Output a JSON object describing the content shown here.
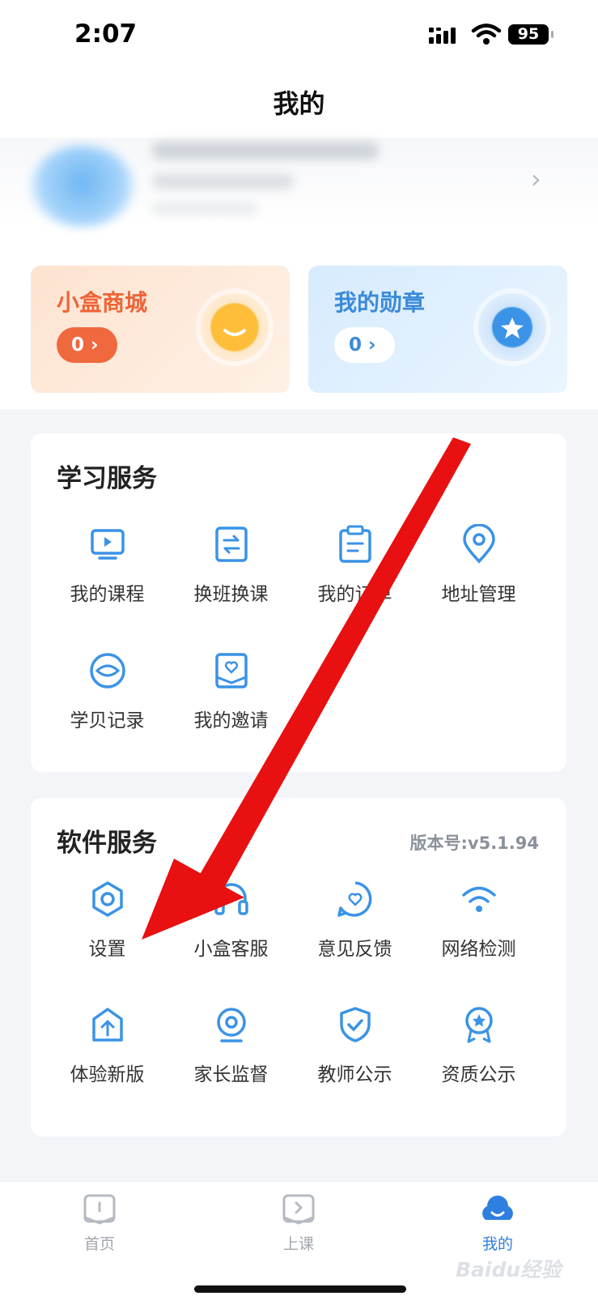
{
  "status": {
    "time": "2:07",
    "battery": "95"
  },
  "page_title": "我的",
  "mall": {
    "title": "小盒商城",
    "count": "0"
  },
  "medal": {
    "title": "我的勋章",
    "count": "0"
  },
  "study": {
    "title": "学习服务",
    "items": [
      {
        "label": "我的课程",
        "icon": "course-icon"
      },
      {
        "label": "换班换课",
        "icon": "switch-class-icon"
      },
      {
        "label": "我的订单",
        "icon": "order-icon"
      },
      {
        "label": "地址管理",
        "icon": "location-icon"
      },
      {
        "label": "学贝记录",
        "icon": "coin-record-icon"
      },
      {
        "label": "我的邀请",
        "icon": "invite-icon"
      }
    ]
  },
  "software": {
    "title": "软件服务",
    "version": "版本号:v5.1.94",
    "items": [
      {
        "label": "设置",
        "icon": "settings-icon"
      },
      {
        "label": "小盒客服",
        "icon": "headset-icon"
      },
      {
        "label": "意见反馈",
        "icon": "feedback-icon"
      },
      {
        "label": "网络检测",
        "icon": "wifi-icon"
      },
      {
        "label": "体验新版",
        "icon": "upgrade-icon"
      },
      {
        "label": "家长监督",
        "icon": "camera-icon"
      },
      {
        "label": "教师公示",
        "icon": "shield-icon"
      },
      {
        "label": "资质公示",
        "icon": "award-icon"
      }
    ]
  },
  "tabs": [
    {
      "label": "首页",
      "icon": "home-book-icon"
    },
    {
      "label": "上课",
      "icon": "play-class-icon"
    },
    {
      "label": "我的",
      "icon": "profile-cloud-icon"
    }
  ],
  "watermark": "Baidu经验",
  "colors": {
    "accent": "#2e7fe0",
    "icon_blue": "#3a93e6",
    "mall_orange": "#f0683e",
    "annotation_red": "#e81010"
  }
}
